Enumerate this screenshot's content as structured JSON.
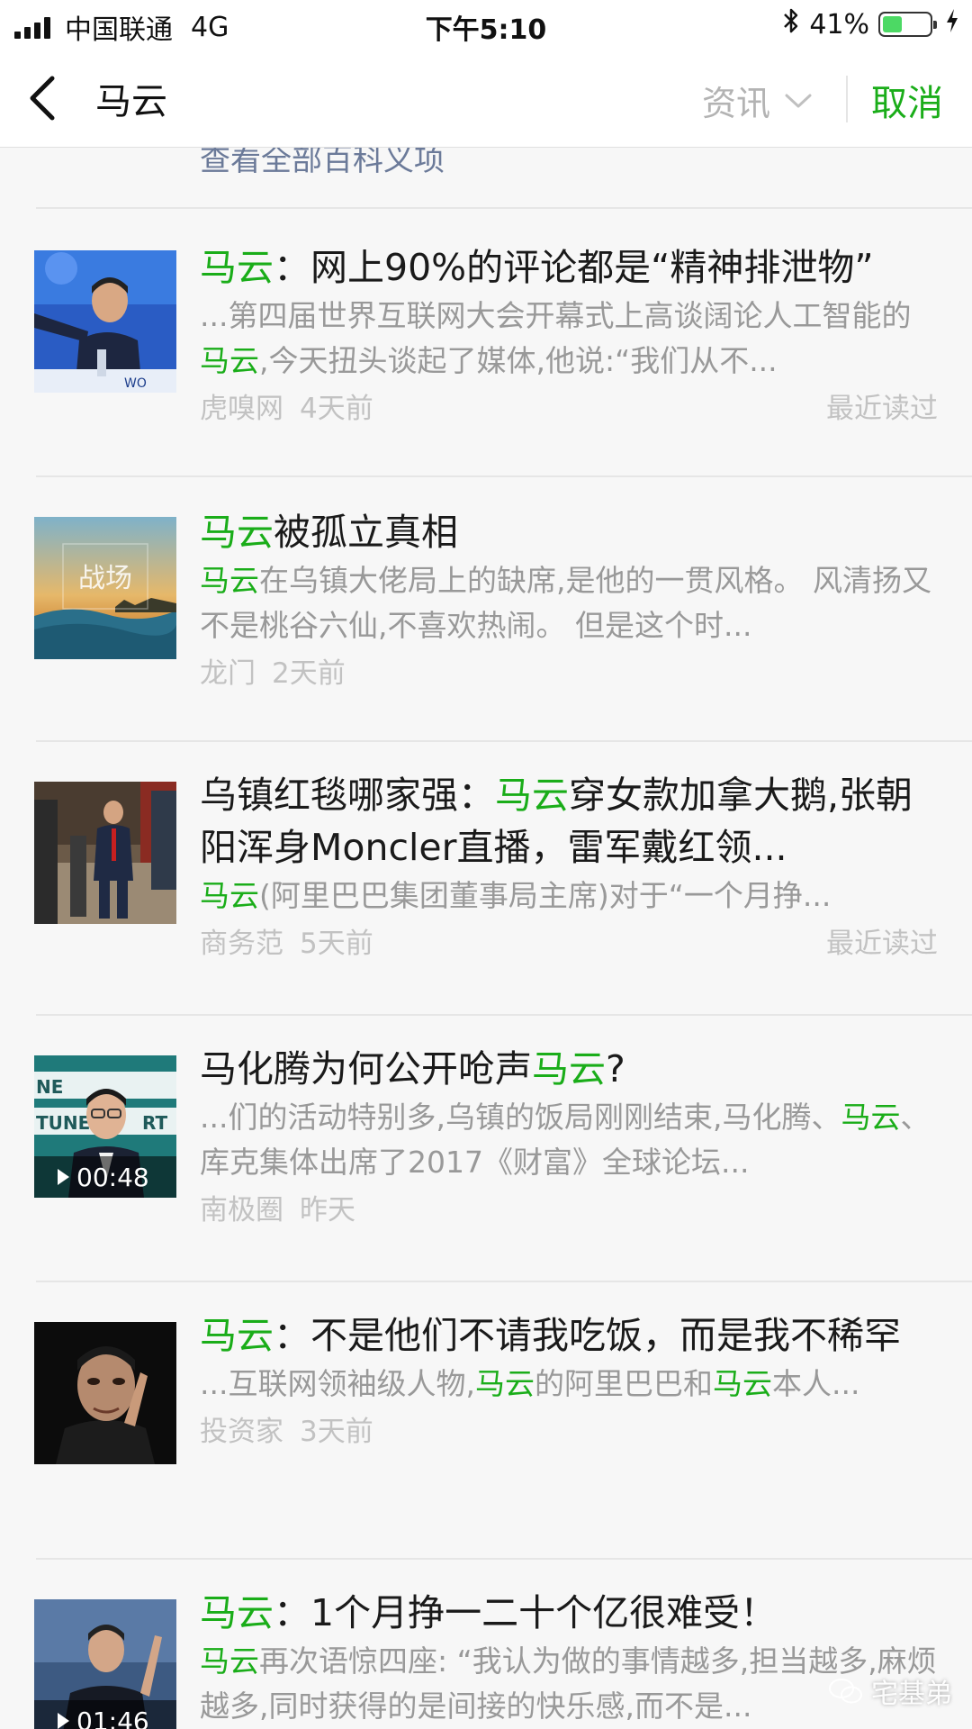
{
  "status_bar": {
    "carrier": "中国联通",
    "network": "4G",
    "time": "下午5:10",
    "battery_percent": "41%",
    "battery_level": 0.41,
    "bluetooth_icon": "bluetooth-icon",
    "charging_icon": "charging-bolt-icon"
  },
  "nav": {
    "query": "马云",
    "filter_label": "资讯",
    "cancel_label": "取消"
  },
  "baike_link": "查看全部百科义项",
  "articles": [
    {
      "title": [
        {
          "t": "马云",
          "h": true
        },
        {
          "t": "：网上90%的评论都是“精神排泄物”",
          "h": false
        }
      ],
      "snippet": [
        {
          "t": "...第四届世界互联网大会开幕式上高谈阔论人工智能的",
          "h": false
        },
        {
          "t": "马云",
          "h": true
        },
        {
          "t": ",今天扭头谈起了媒体,他说:“我们从不...",
          "h": false
        }
      ],
      "source": "虎嗅网",
      "time": "4天前",
      "read": "最近读过"
    },
    {
      "title": [
        {
          "t": "马云",
          "h": true
        },
        {
          "t": "被孤立真相",
          "h": false
        }
      ],
      "snippet": [
        {
          "t": "马云",
          "h": true
        },
        {
          "t": "在乌镇大佬局上的缺席,是他的一贯风格。 风清扬又不是桃谷六仙,不喜欢热闹。 但是这个时...",
          "h": false
        }
      ],
      "source": "龙门",
      "time": "2天前",
      "read": "",
      "thumb_text": "战场"
    },
    {
      "title": [
        {
          "t": "乌镇红毯哪家强：",
          "h": false
        },
        {
          "t": "马云",
          "h": true
        },
        {
          "t": "穿女款加拿大鹅,张朝阳浑身Moncler直播，雷军戴红领...",
          "h": false
        }
      ],
      "snippet": [
        {
          "t": "马云",
          "h": true
        },
        {
          "t": "(阿里巴巴集团董事局主席)对于“一个月挣...",
          "h": false
        }
      ],
      "source": "商务范",
      "time": "5天前",
      "read": "最近读过"
    },
    {
      "title": [
        {
          "t": "马化腾为何公开呛声",
          "h": false
        },
        {
          "t": "马云",
          "h": true
        },
        {
          "t": "?",
          "h": false
        }
      ],
      "snippet": [
        {
          "t": "...们的活动特别多,乌镇的饭局刚刚结束,马化腾、",
          "h": false
        },
        {
          "t": "马云",
          "h": true
        },
        {
          "t": "、库克集体出席了2017《财富》全球论坛...",
          "h": false
        }
      ],
      "source": "南极圈",
      "time": "昨天",
      "read": "",
      "duration": "00:48"
    },
    {
      "title": [
        {
          "t": "马云",
          "h": true
        },
        {
          "t": "：不是他们不请我吃饭，而是我不稀罕",
          "h": false
        }
      ],
      "snippet": [
        {
          "t": "...互联网领袖级人物,",
          "h": false
        },
        {
          "t": "马云",
          "h": true
        },
        {
          "t": "的阿里巴巴和",
          "h": false
        },
        {
          "t": "马云",
          "h": true
        },
        {
          "t": "本人...",
          "h": false
        }
      ],
      "source": "投资家",
      "time": "3天前",
      "read": ""
    },
    {
      "title": [
        {
          "t": "马云",
          "h": true
        },
        {
          "t": "：1个月挣一二十个亿很难受！",
          "h": false
        }
      ],
      "snippet": [
        {
          "t": "马云",
          "h": true
        },
        {
          "t": "再次语惊四座: “我认为做的事情越多,担当越多,麻烦越多,同时获得的是间接的快乐感,而不是...",
          "h": false
        }
      ],
      "source": "",
      "time": "",
      "read": "",
      "duration": "01:46"
    }
  ],
  "watermark": "宅基弟",
  "colors": {
    "highlight": "#1aad19",
    "snippet": "#999999",
    "meta": "#c2c2c2",
    "battery": "#4cd964"
  }
}
